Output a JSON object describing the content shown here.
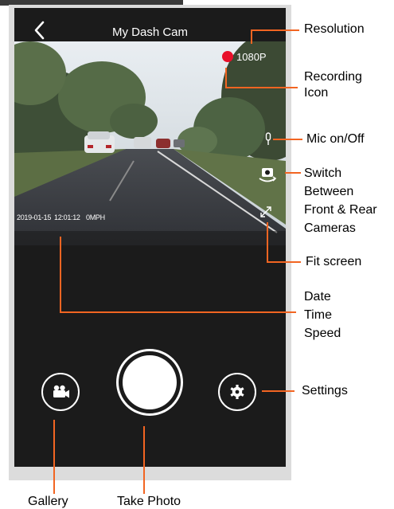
{
  "app": {
    "title": "My Dash Cam"
  },
  "video": {
    "resolution": "1080P",
    "date": "2019-01-15",
    "time": "12:01:12",
    "speed": "0MPH"
  },
  "annotations": {
    "resolution": "Resolution",
    "recording_icon": [
      "Recording",
      "Icon"
    ],
    "mic": "Mic on/Off",
    "switch_cameras": [
      "Switch",
      "Between",
      "Front & Rear",
      "Cameras"
    ],
    "fit_screen": "Fit screen",
    "date_time_speed": [
      "Date",
      "Time",
      "Speed"
    ],
    "settings": "Settings",
    "gallery": "Gallery",
    "take_photo": "Take Photo"
  },
  "colors": {
    "accent": "#f26522",
    "recording": "#e8102a",
    "screen_bg": "#1b1b1b"
  },
  "icons": {
    "back": "chevron-left-icon",
    "mic": "microphone-icon",
    "switch": "camera-switch-icon",
    "fit": "expand-icon",
    "gallery": "video-camera-icon",
    "settings": "gear-icon"
  }
}
